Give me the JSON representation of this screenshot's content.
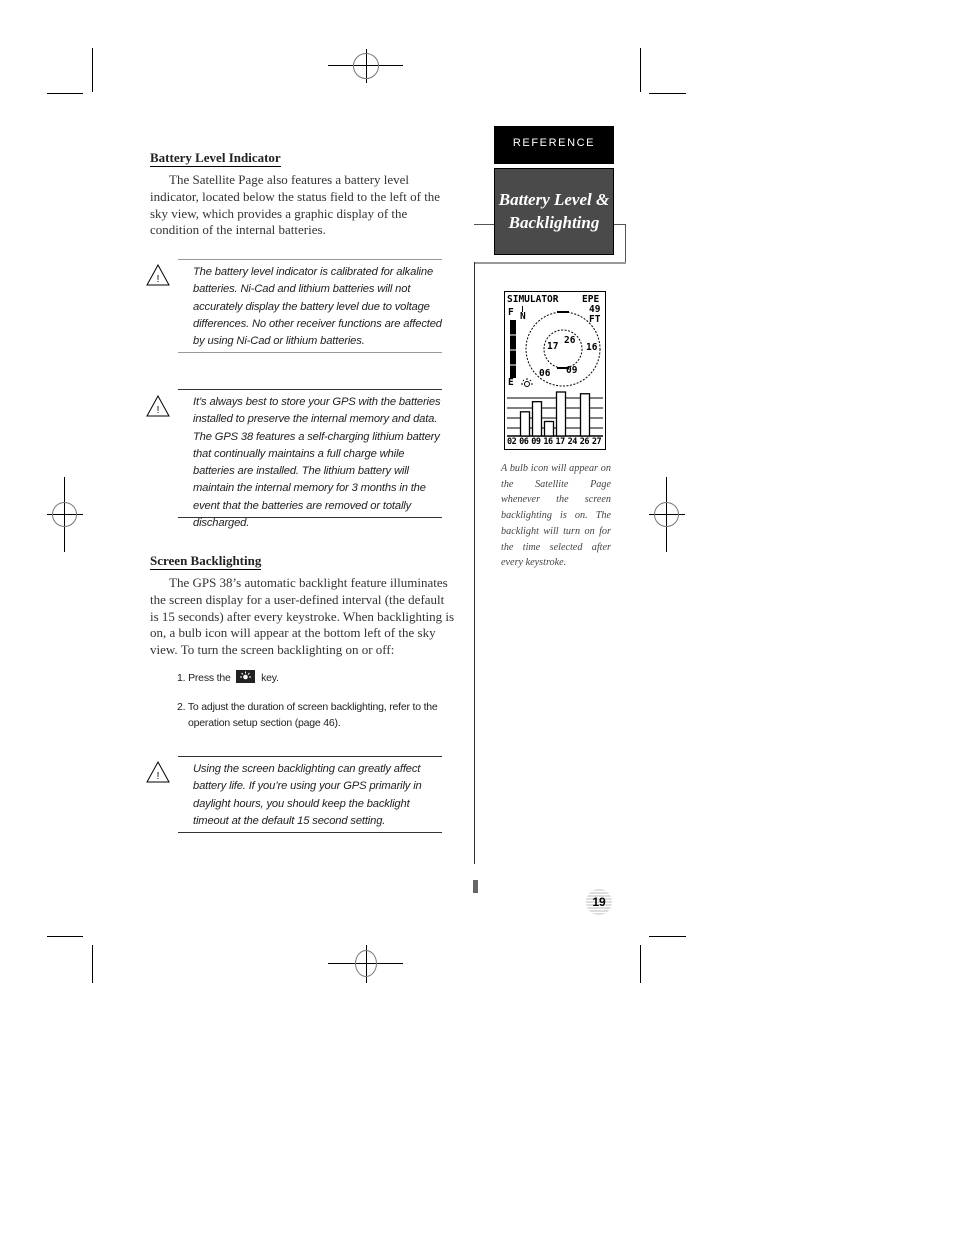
{
  "sidebar": {
    "section_tab": "REFERENCE",
    "title_line1": "Battery Level &",
    "title_line2": "Backlighting"
  },
  "battery_section": {
    "heading": "Battery Level Indicator",
    "paragraph": "The Satellite Page also features a battery level indicator, located below the status field to the left of the sky view, which provides a graphic display of the condition of the internal batteries."
  },
  "notes": [
    {
      "icon": "warning-triangle-icon",
      "text": "The battery level indicator is calibrated for alkaline batteries. Ni-Cad and lithium batteries will not accurately display the battery level due to voltage differences. No other receiver functions are affected by using Ni-Cad or lithium batteries."
    },
    {
      "icon": "warning-triangle-icon",
      "text": "It’s always best to store your GPS with the batteries installed to preserve the internal memory and data. The GPS 38 features a self-charging lithium battery that continually maintains a full charge while batteries are installed. The lithium battery will maintain the internal memory for 3 months in the event that the batteries are removed or totally discharged."
    },
    {
      "icon": "warning-triangle-icon",
      "text": "Using the screen backlighting can greatly affect battery life. If you’re using your GPS primarily in daylight hours, you should keep the backlight timeout at the default 15 second setting."
    }
  ],
  "backlight_section": {
    "heading": "Screen Backlighting",
    "paragraph": "The GPS 38’s automatic backlight feature illuminates the screen display for a user-defined interval (the default is 15 seconds) after every keystroke. When backlighting is on, a bulb icon will appear at the bottom left of the sky view. To turn the screen backlighting on or off:",
    "steps": [
      {
        "before": "1. Press the",
        "icon": "backlight-key-icon",
        "after": "key."
      },
      {
        "line1": "2. To adjust the duration of screen backlighting, refer to the",
        "line2": "operation setup section (page 46)."
      }
    ]
  },
  "gps_screen": {
    "status": "SIMULATOR",
    "epe_label": "EPE",
    "epe_value": "49",
    "epe_unit": "FT",
    "battery_full_label": "F",
    "battery_empty_label": "E",
    "battery_level": 1.0,
    "north_label": "N",
    "satellites_sky": [
      "17",
      "26",
      "16",
      "06",
      "09"
    ],
    "signal_bars": {
      "labels": [
        "02",
        "06",
        "09",
        "16",
        "17",
        "24",
        "26",
        "27"
      ],
      "strengths": [
        0,
        0.55,
        0.78,
        0.33,
        1.0,
        0,
        0.96,
        0
      ]
    },
    "backlight_icon": "bulb-icon"
  },
  "caption": "A bulb icon will appear on the Satellite Page whenever the screen backlighting is on. The backlight will turn on for the time selected after every keystroke.",
  "page_number": "19"
}
